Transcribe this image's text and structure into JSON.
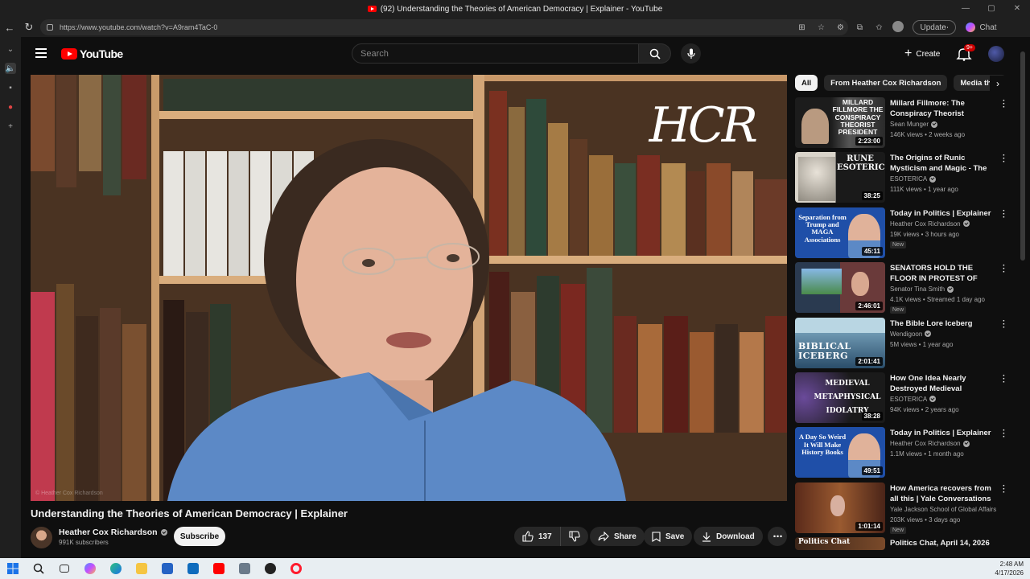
{
  "window": {
    "title": "(92) Understanding the Theories of American Democracy | Explainer - YouTube"
  },
  "browser": {
    "url": "https://www.youtube.com/watch?v=A9ram4TaC-0",
    "update_label": "Update",
    "chat_label": "Chat"
  },
  "youtube": {
    "logo_text": "YouTube",
    "search_placeholder": "Search",
    "create_label": "Create",
    "notification_count": "9+"
  },
  "player": {
    "overlay_logo": "HCR",
    "watermark": "© Heather Cox Richardson"
  },
  "video": {
    "title": "Understanding the Theories of American Democracy | Explainer",
    "channel": "Heather Cox Richardson",
    "subscribers": "991K subscribers",
    "subscribe_label": "Subscribe",
    "likes": "137",
    "share_label": "Share",
    "save_label": "Save",
    "download_label": "Download"
  },
  "chips": [
    "All",
    "From Heather Cox Richardson",
    "Media theo"
  ],
  "recommendations": [
    {
      "title": "Millard Fillmore: The Conspiracy Theorist President",
      "channel": "Sean Munger",
      "meta": "146K views • 2 weeks ago",
      "duration": "2:23:00",
      "thumb_text": "MILLARD FILLMORE THE CONSPIRACY THEORIST PRESIDENT",
      "new": ""
    },
    {
      "title": "The Origins of Runic Mysticism and Magic - The Kabbalistic ...",
      "channel": "ESOTERICA",
      "meta": "111K views • 1 year ago",
      "duration": "38:25",
      "thumb_text": "RUNE ESOTERICISM",
      "new": ""
    },
    {
      "title": "Today in Politics | Explainer",
      "channel": "Heather Cox Richardson",
      "meta": "19K views • 3 hours ago",
      "duration": "45:11",
      "thumb_text": "Separation from Trump and MAGA Associations",
      "new": "New"
    },
    {
      "title": "SENATORS HOLD THE FLOOR IN PROTEST OF COPPER-...",
      "channel": "Senator Tina Smith",
      "meta": "4.1K views • Streamed 1 day ago",
      "duration": "2:46:01",
      "thumb_text": "",
      "new": "New"
    },
    {
      "title": "The Bible Lore Iceberg",
      "channel": "Wendigoon",
      "meta": "5M views • 1 year ago",
      "duration": "2:01:41",
      "thumb_text": "BIBLICAL ICEBERG",
      "new": ""
    },
    {
      "title": "How One Idea Nearly Destroyed Medieval Philosophy & ...",
      "channel": "ESOTERICA",
      "meta": "94K views • 2 years ago",
      "duration": "38:28",
      "thumb_text": "MEDIEVAL METAPHYSICAL IDOLATRY",
      "new": ""
    },
    {
      "title": "Today in Politics | Explainer",
      "channel": "Heather Cox Richardson",
      "meta": "1.1M views • 1 month ago",
      "duration": "49:51",
      "thumb_text": "A Day So Weird It Will Make History Books",
      "new": ""
    },
    {
      "title": "How America recovers from all this | Yale Conversations with ...",
      "channel": "Yale Jackson School of Global Affairs",
      "meta": "203K views • 3 days ago",
      "duration": "1:01:14",
      "thumb_text": "",
      "new": "New"
    },
    {
      "title": "Politics Chat, April 14, 2026",
      "channel": "",
      "meta": "",
      "duration": "",
      "thumb_text": "Politics Chat",
      "new": ""
    }
  ],
  "taskbar": {
    "time": "2:48 AM",
    "date": "4/17/2026"
  },
  "colors": {
    "background": "#0f0f0f",
    "youtube_red": "#ff0000",
    "pill_bg": "#272727"
  }
}
